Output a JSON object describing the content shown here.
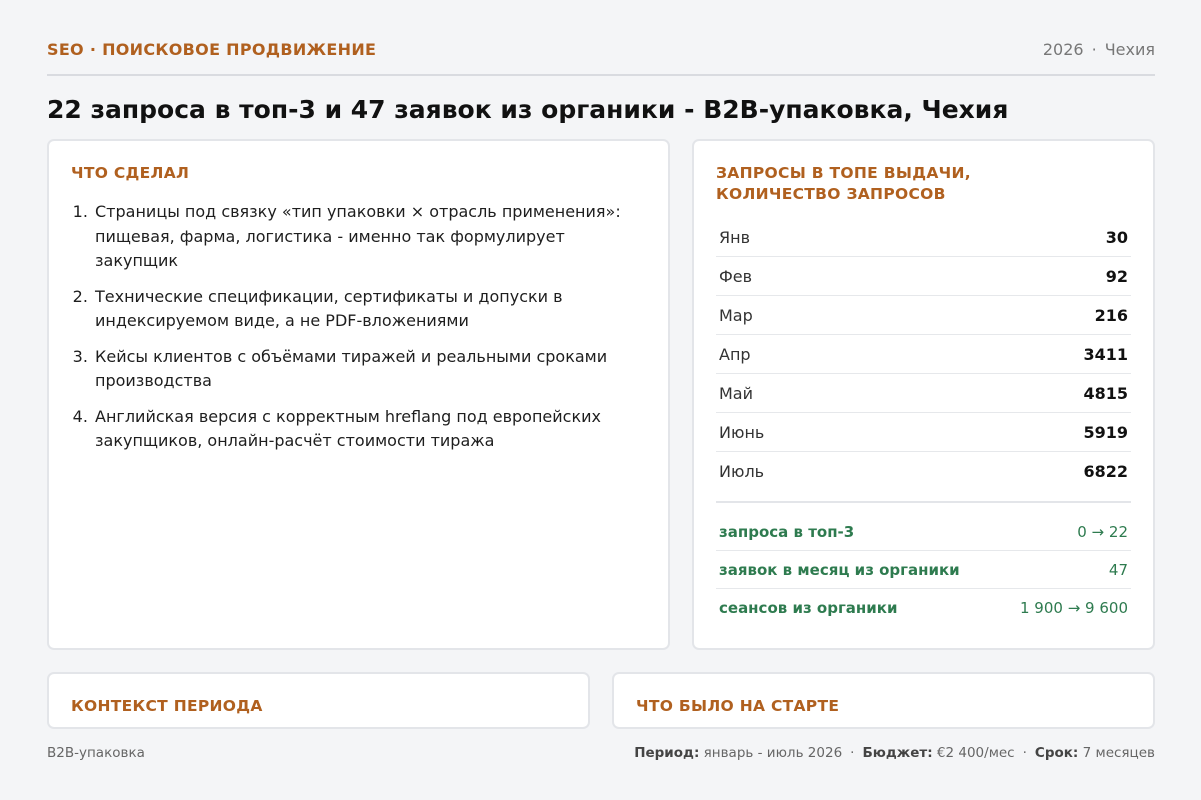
{
  "header": {
    "section": "SEO · ПОИСКОВОЕ ПРОДВИЖЕНИЕ",
    "year": "2026",
    "country": "Чехия"
  },
  "headline": "22 запроса в топ-3 и 47 заявок из органики - B2B-упаковка, Чехия",
  "done": {
    "title": "ЧТО СДЕЛАЛ",
    "items": [
      "Страницы под связку «тип упаковки × отрасль применения»: пищевая, фарма, логистика - именно так формулирует закупщик",
      "Технические спецификации, сертификаты и допуски в индексируемом виде, а не PDF-вложениями",
      "Кейсы клиентов с объёмами тиражей и реальными сроками производства",
      "Английская версия с корректным hreflang под европейских закупщиков, онлайн-расчёт стоимости тиража"
    ]
  },
  "queries": {
    "title": "ЗАПРОСЫ В ТОПЕ ВЫДАЧИ, КОЛИЧЕСТВО ЗАПРОСОВ",
    "months": [
      {
        "label": "Янв",
        "value": "30"
      },
      {
        "label": "Фев",
        "value": "92"
      },
      {
        "label": "Мар",
        "value": "216"
      },
      {
        "label": "Апр",
        "value": "3411"
      },
      {
        "label": "Май",
        "value": "4815"
      },
      {
        "label": "Июнь",
        "value": "5919"
      },
      {
        "label": "Июль",
        "value": "6822"
      }
    ],
    "kpis": [
      {
        "label": "запроса в топ-3",
        "value": "0 → 22"
      },
      {
        "label": "заявок в месяц из органики",
        "value": "47"
      },
      {
        "label": "сеансов из органики",
        "value": "1 900 → 9 600"
      }
    ]
  },
  "context": {
    "title": "КОНТЕКСТ ПЕРИОДА"
  },
  "start": {
    "title": "ЧТО БЫЛО НА СТАРТЕ"
  },
  "footer": {
    "niche": "B2B-упаковка",
    "period_label": "Период:",
    "period_value": "январь - июль 2026",
    "budget_label": "Бюджет:",
    "budget_value": "€2 400/мес",
    "term_label": "Срок:",
    "term_value": "7 месяцев"
  },
  "colors": {
    "accent": "#b0601f",
    "kpi": "#2e7b4f",
    "background": "#f4f5f7"
  }
}
